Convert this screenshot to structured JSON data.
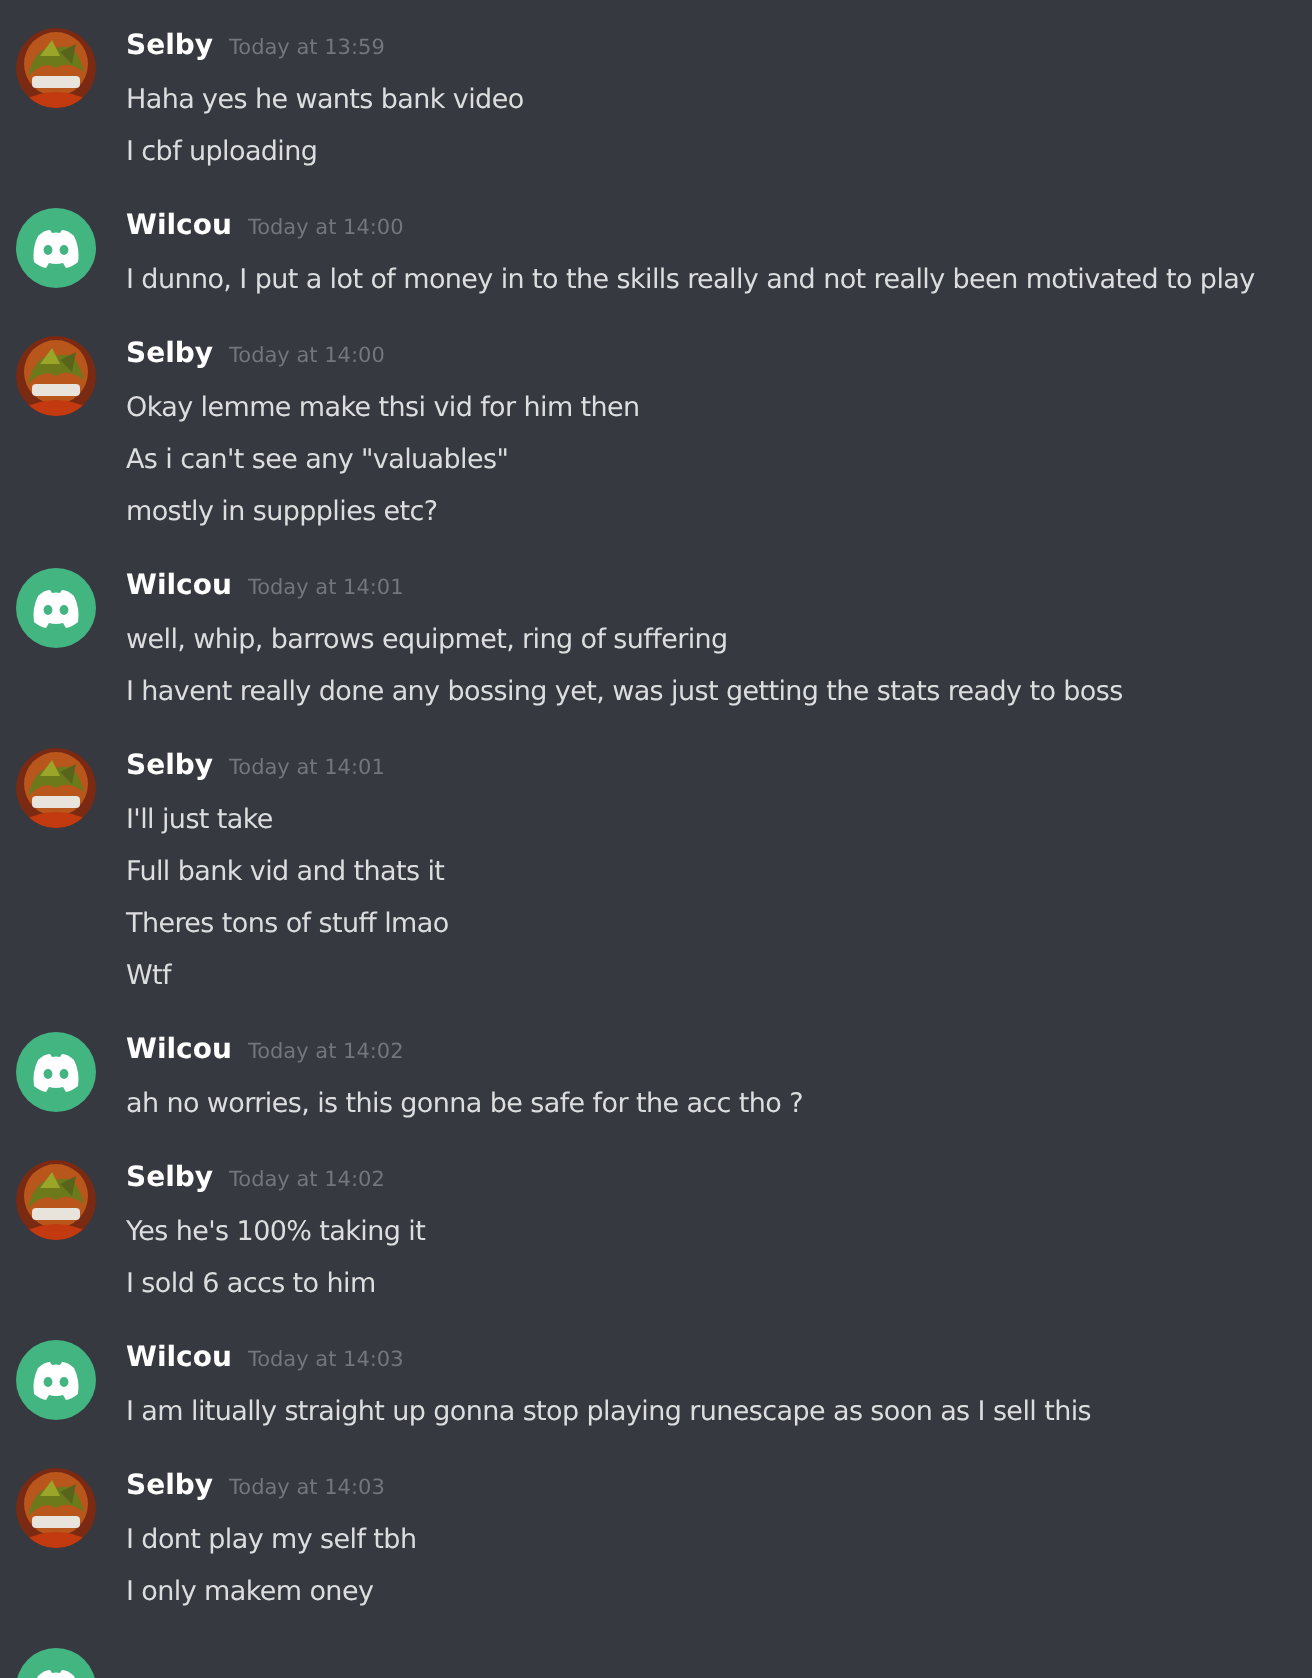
{
  "messages": [
    {
      "author": "Selby",
      "kind": "picture",
      "timestamp": "Today at 13:59",
      "lines": [
        "Haha yes he wants bank video",
        "I cbf uploading"
      ]
    },
    {
      "author": "Wilcou",
      "kind": "discord",
      "timestamp": "Today at 14:00",
      "lines": [
        "I dunno, I put a lot of money in to the skills really and not really been motivated to play"
      ]
    },
    {
      "author": "Selby",
      "kind": "picture",
      "timestamp": "Today at 14:00",
      "lines": [
        "Okay lemme make thsi vid for him then",
        "As i can't see any \"valuables\"",
        "mostly in suppplies etc?"
      ]
    },
    {
      "author": "Wilcou",
      "kind": "discord",
      "timestamp": "Today at 14:01",
      "lines": [
        "well, whip, barrows equipmet, ring of suffering",
        "I havent really done any bossing yet, was just getting the stats ready to boss"
      ]
    },
    {
      "author": "Selby",
      "kind": "picture",
      "timestamp": "Today at 14:01",
      "lines": [
        "I'll just take",
        "Full bank vid and thats it",
        "Theres tons of stuff lmao",
        "Wtf"
      ]
    },
    {
      "author": "Wilcou",
      "kind": "discord",
      "timestamp": "Today at 14:02",
      "lines": [
        "ah no worries, is this gonna be safe for the acc tho ?"
      ]
    },
    {
      "author": "Selby",
      "kind": "picture",
      "timestamp": "Today at 14:02",
      "lines": [
        "Yes he's 100% taking it",
        "I sold 6 accs to him"
      ]
    },
    {
      "author": "Wilcou",
      "kind": "discord",
      "timestamp": "Today at 14:03",
      "lines": [
        "I am litually straight up gonna stop playing runescape as soon as I sell this"
      ]
    },
    {
      "author": "Selby",
      "kind": "picture",
      "timestamp": "Today at 14:03",
      "lines": [
        "I dont play my self tbh",
        "I only makem oney"
      ]
    },
    {
      "kind": "discord"
    }
  ]
}
